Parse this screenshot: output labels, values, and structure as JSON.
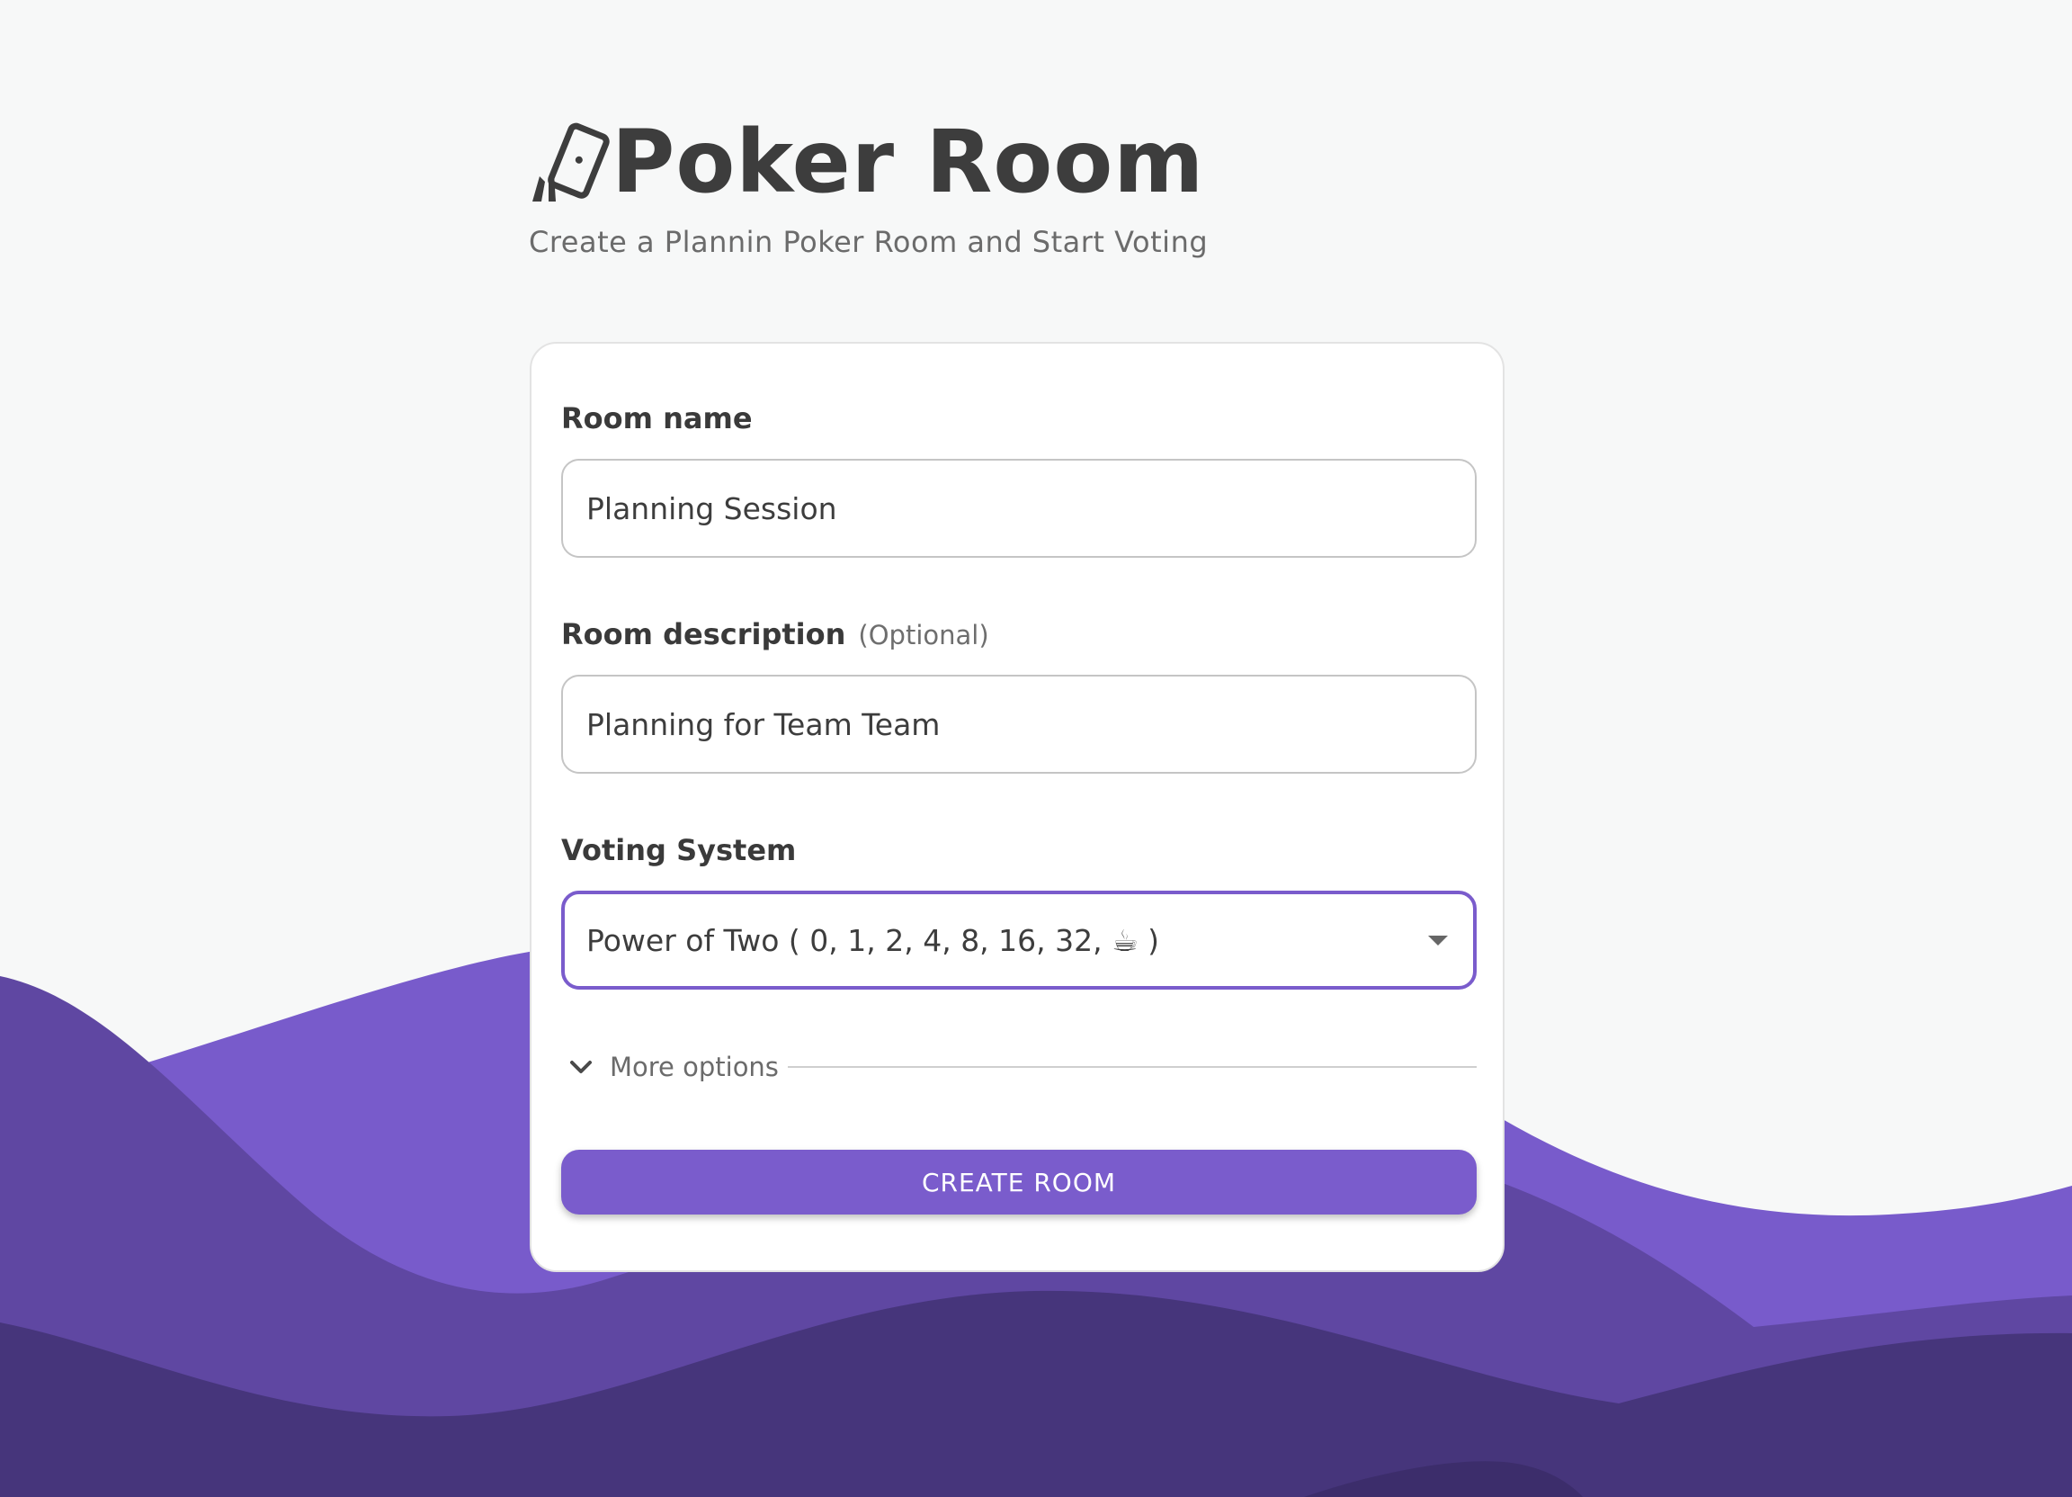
{
  "header": {
    "title": "Poker Room",
    "subtitle": "Create a Plannin Poker Room and Start Voting",
    "logo_icon": "cards-icon"
  },
  "form": {
    "room_name": {
      "label": "Room name",
      "value": "Planning Session"
    },
    "room_description": {
      "label": "Room description",
      "optional_label": "(Optional)",
      "value": "Planning for Team Team"
    },
    "voting_system": {
      "label": "Voting System",
      "selected": "Power of Two ( 0, 1, 2, 4, 8, 16, 32, ☕ )"
    },
    "more_options_label": "More options",
    "create_button_label": "CREATE ROOM"
  },
  "colors": {
    "accent": "#7a5ccc",
    "wave_light": "#785bcb",
    "wave_mid": "#5f47a2",
    "wave_dark": "#46357b",
    "background": "#f7f8f8"
  }
}
